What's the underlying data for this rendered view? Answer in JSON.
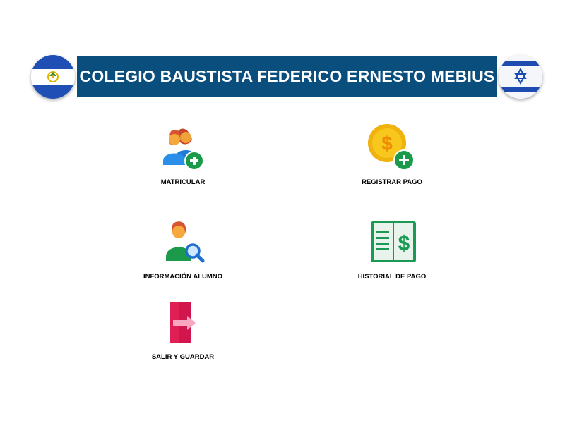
{
  "header": {
    "title": "COLEGIO BAUSTISTA FEDERICO ERNESTO MEBIUS",
    "left_flag_icon": "el-salvador-flag-icon",
    "right_flag_icon": "israel-flag-icon",
    "banner_color": "#0a4e7d"
  },
  "menu": {
    "matricular": {
      "label": "MATRICULAR",
      "icon": "add-users-icon"
    },
    "registrar_pago": {
      "label": "REGISTRAR PAGO",
      "icon": "add-coin-icon"
    },
    "informacion_alumno": {
      "label": "INFORMACIÓN ALUMNO",
      "icon": "search-user-icon"
    },
    "historial_pago": {
      "label": "HISTORIAL DE PAGO",
      "icon": "payment-ledger-icon"
    },
    "salir_guardar": {
      "label": "SALIR Y GUARDAR",
      "icon": "exit-icon"
    }
  }
}
